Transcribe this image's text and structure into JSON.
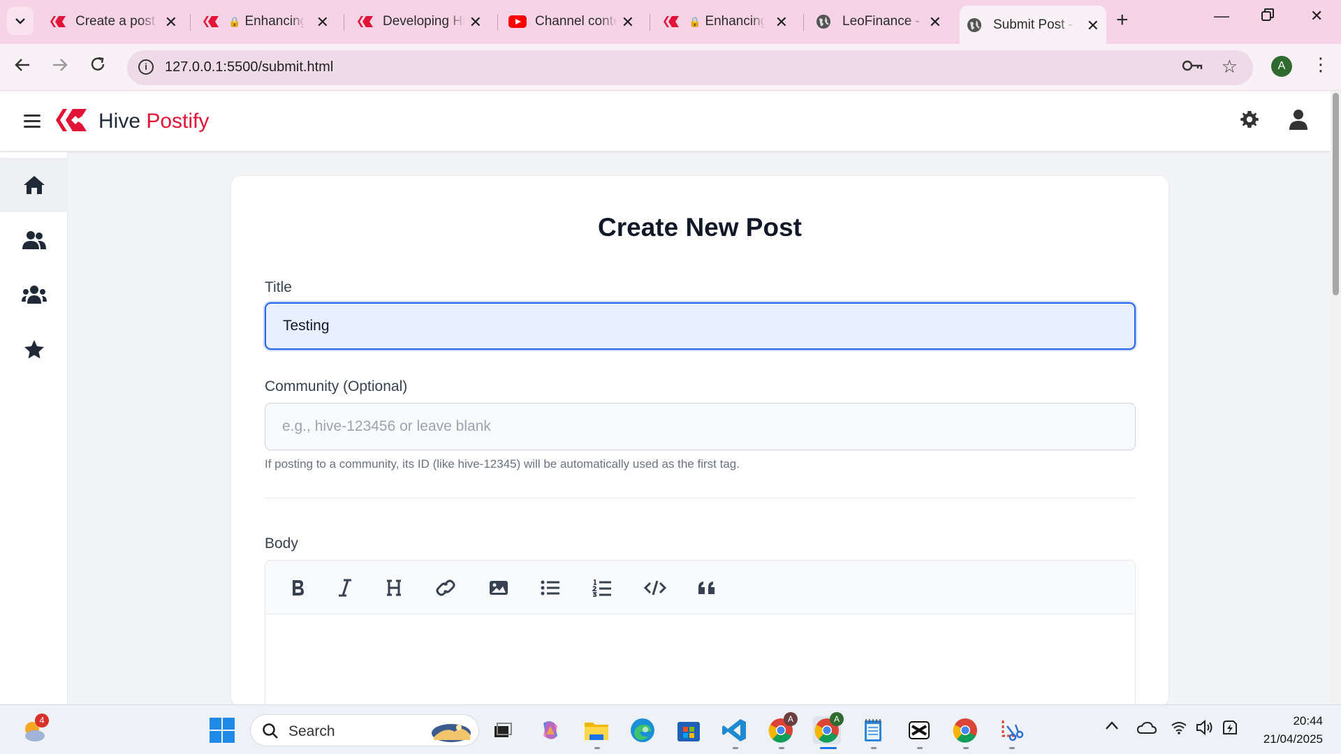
{
  "browser": {
    "tabs": [
      {
        "label": "Create a post",
        "favicon": "hive-icon",
        "active": false
      },
      {
        "label": "Enhancing",
        "favicon": "hive-icon",
        "locked": true,
        "active": false
      },
      {
        "label": "Developing Hi",
        "favicon": "hive-icon",
        "active": false
      },
      {
        "label": "Channel conte",
        "favicon": "youtube-icon",
        "active": false
      },
      {
        "label": "Enhancing",
        "favicon": "hive-icon",
        "locked": true,
        "active": false
      },
      {
        "label": "LeoFinance - I",
        "favicon": "globe-icon",
        "active": false
      },
      {
        "label": "Submit Post -",
        "favicon": "globe-icon",
        "active": true
      }
    ],
    "url": "127.0.0.1:5500/submit.html",
    "profile_initial": "A"
  },
  "app": {
    "brand_first": "Hive",
    "brand_second": "Postify",
    "brand_color": "#e31337"
  },
  "form": {
    "heading": "Create New Post",
    "title_label": "Title",
    "title_value": "Testing",
    "community_label": "Community (Optional)",
    "community_placeholder": "e.g., hive-123456 or leave blank",
    "community_hint": "If posting to a community, its ID (like hive-12345) will be automatically used as the first tag.",
    "body_label": "Body",
    "toolbar_tools": [
      "bold-icon",
      "italic-icon",
      "heading-icon",
      "link-icon",
      "image-icon",
      "bullet-list-icon",
      "numbered-list-icon",
      "code-icon",
      "quote-icon"
    ]
  },
  "sidebar": {
    "items": [
      "home-icon",
      "users-icon",
      "group-icon",
      "star-icon"
    ]
  },
  "taskbar": {
    "search_label": "Search",
    "time": "20:44",
    "date": "21/04/2025",
    "weather_badge": "4",
    "chrome_badge_1": "A",
    "chrome_badge_2": "A"
  }
}
